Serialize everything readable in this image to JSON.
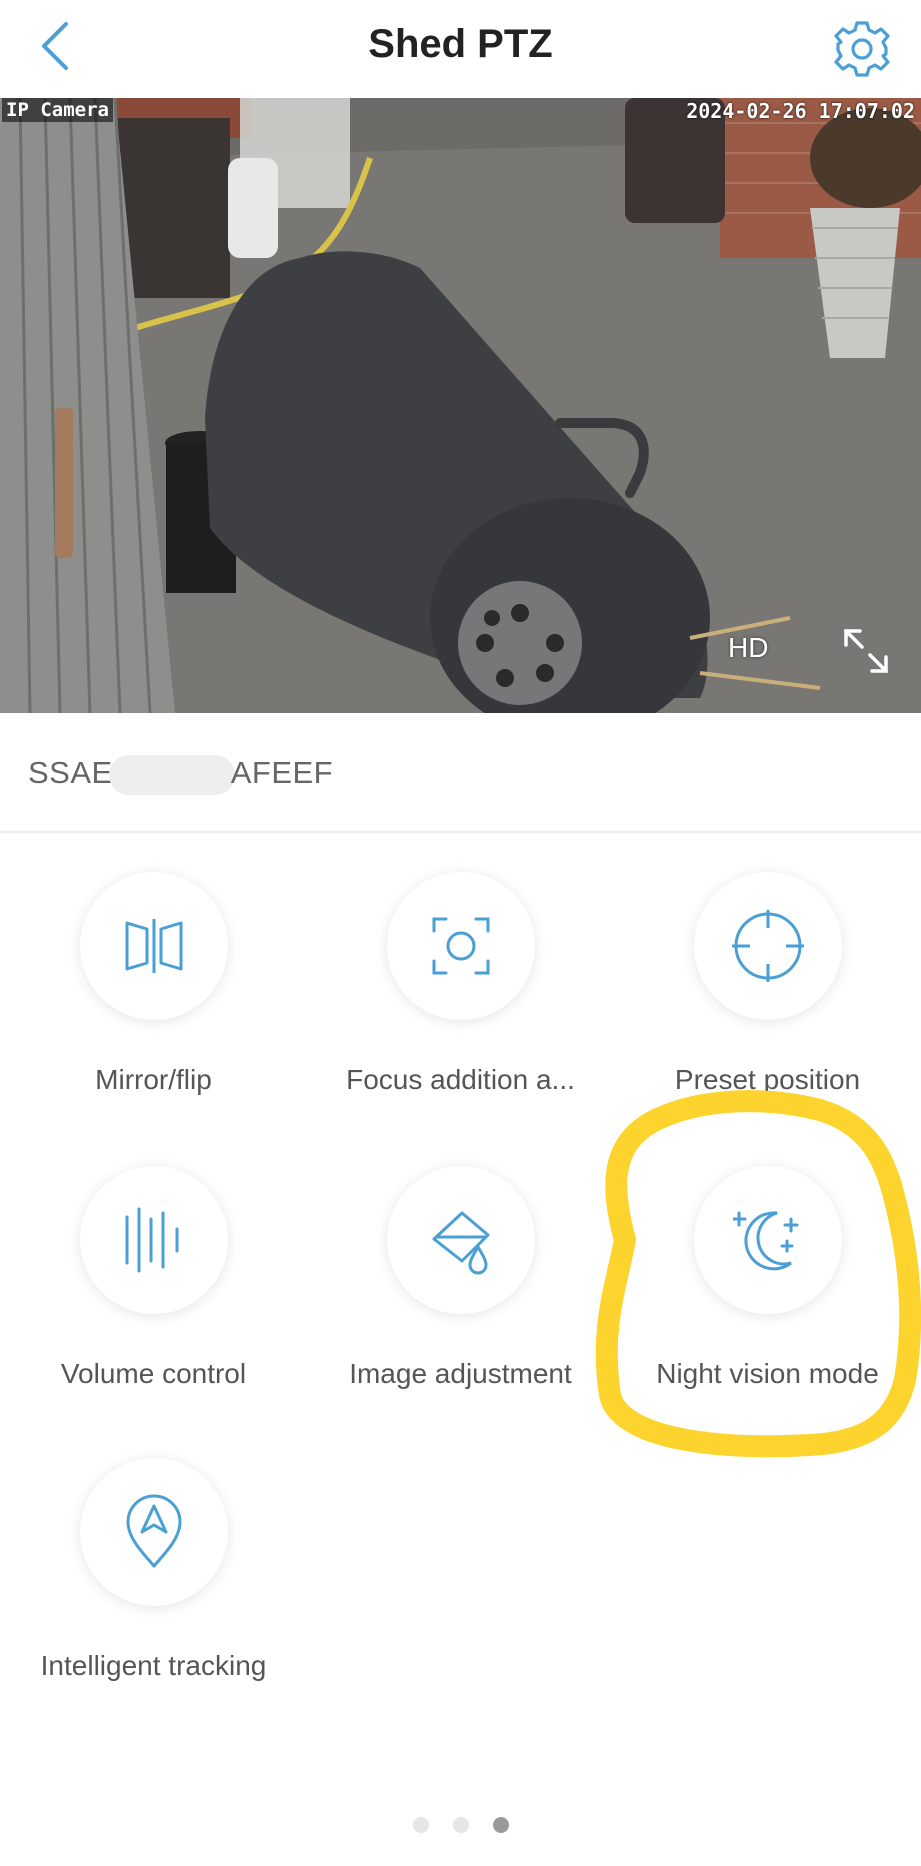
{
  "header": {
    "title": "Shed PTZ",
    "back_icon": "chevron-left-icon",
    "settings_icon": "gear-icon"
  },
  "video": {
    "osd_camera_name": "IP Camera",
    "osd_timestamp": "2024-02-26 17:07:02",
    "quality_label": "HD",
    "fullscreen_icon": "expand-icon"
  },
  "device": {
    "id_prefix": "SSAE",
    "id_suffix": "AFEEF"
  },
  "features": [
    {
      "label": "Mirror/flip",
      "icon": "mirror-flip-icon"
    },
    {
      "label": "Focus addition a...",
      "icon": "focus-icon"
    },
    {
      "label": "Preset position",
      "icon": "crosshair-icon"
    },
    {
      "label": "Volume control",
      "icon": "volume-bars-icon"
    },
    {
      "label": "Image adjustment",
      "icon": "paint-bucket-icon"
    },
    {
      "label": "Night vision mode",
      "icon": "moon-stars-icon"
    },
    {
      "label": "Intelligent tracking",
      "icon": "location-arrow-icon"
    }
  ],
  "pager": {
    "count": 3,
    "active": 3
  },
  "colors": {
    "accent": "#4a9fd5",
    "highlight": "#fdd42d",
    "label_text": "#555555"
  }
}
